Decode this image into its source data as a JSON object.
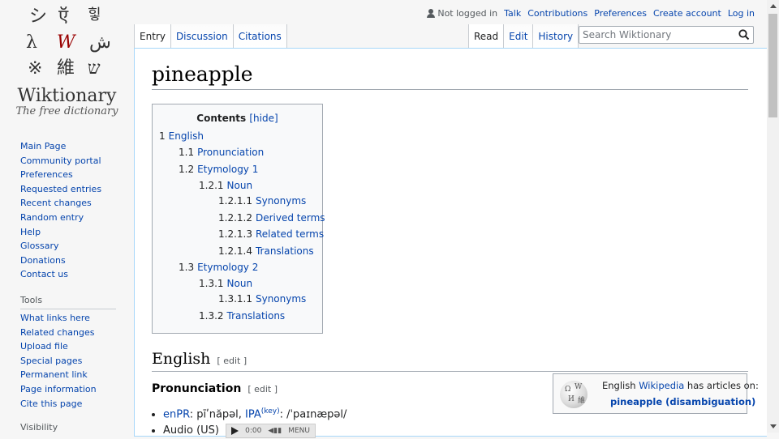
{
  "logo": {
    "glyphs": [
      "シ",
      "ऍ",
      "힣",
      "λ",
      "W",
      "ش",
      "※",
      "維",
      "ש"
    ],
    "title": "Wiktionary",
    "tagline": "The free dictionary"
  },
  "sidebar": {
    "nav": [
      "Main Page",
      "Community portal",
      "Preferences",
      "Requested entries",
      "Recent changes",
      "Random entry",
      "Help",
      "Glossary",
      "Donations",
      "Contact us"
    ],
    "tools_heading": "Tools",
    "tools": [
      "What links here",
      "Related changes",
      "Upload file",
      "Special pages",
      "Permanent link",
      "Page information",
      "Cite this page"
    ],
    "visibility_heading": "Visibility"
  },
  "personal": {
    "status": "Not logged in",
    "links": [
      "Talk",
      "Contributions",
      "Preferences",
      "Create account",
      "Log in"
    ]
  },
  "tabs": {
    "left": [
      "Entry",
      "Discussion",
      "Citations"
    ],
    "right": [
      "Read",
      "Edit",
      "History"
    ]
  },
  "search": {
    "placeholder": "Search Wiktionary"
  },
  "page": {
    "title": "pineapple",
    "toc": {
      "title": "Contents",
      "hide": "[hide]",
      "items": [
        {
          "num": "1",
          "label": "English"
        },
        {
          "num": "1.1",
          "label": "Pronunciation"
        },
        {
          "num": "1.2",
          "label": "Etymology 1"
        },
        {
          "num": "1.2.1",
          "label": "Noun"
        },
        {
          "num": "1.2.1.1",
          "label": "Synonyms"
        },
        {
          "num": "1.2.1.2",
          "label": "Derived terms"
        },
        {
          "num": "1.2.1.3",
          "label": "Related terms"
        },
        {
          "num": "1.2.1.4",
          "label": "Translations"
        },
        {
          "num": "1.3",
          "label": "Etymology 2"
        },
        {
          "num": "1.3.1",
          "label": "Noun"
        },
        {
          "num": "1.3.1.1",
          "label": "Synonyms"
        },
        {
          "num": "1.3.2",
          "label": "Translations"
        }
      ]
    },
    "h2": "English",
    "edit": "[ edit ]",
    "h3": "Pronunciation",
    "wikipedia_box": {
      "prefix": "English ",
      "link": "Wikipedia",
      "suffix": " has articles on:",
      "article": "pineapple (disambiguation)"
    },
    "pronunciation": {
      "enpr_label": "enPR",
      "enpr_value": ": pīʹnăpəl, ",
      "ipa_label": "IPA",
      "ipa_key": "(key)",
      "ipa_value": ": /ˈpaɪnæpəl/",
      "audio_label": "Audio (US)",
      "audio_time": "0:00",
      "audio_menu": "MENU"
    }
  }
}
